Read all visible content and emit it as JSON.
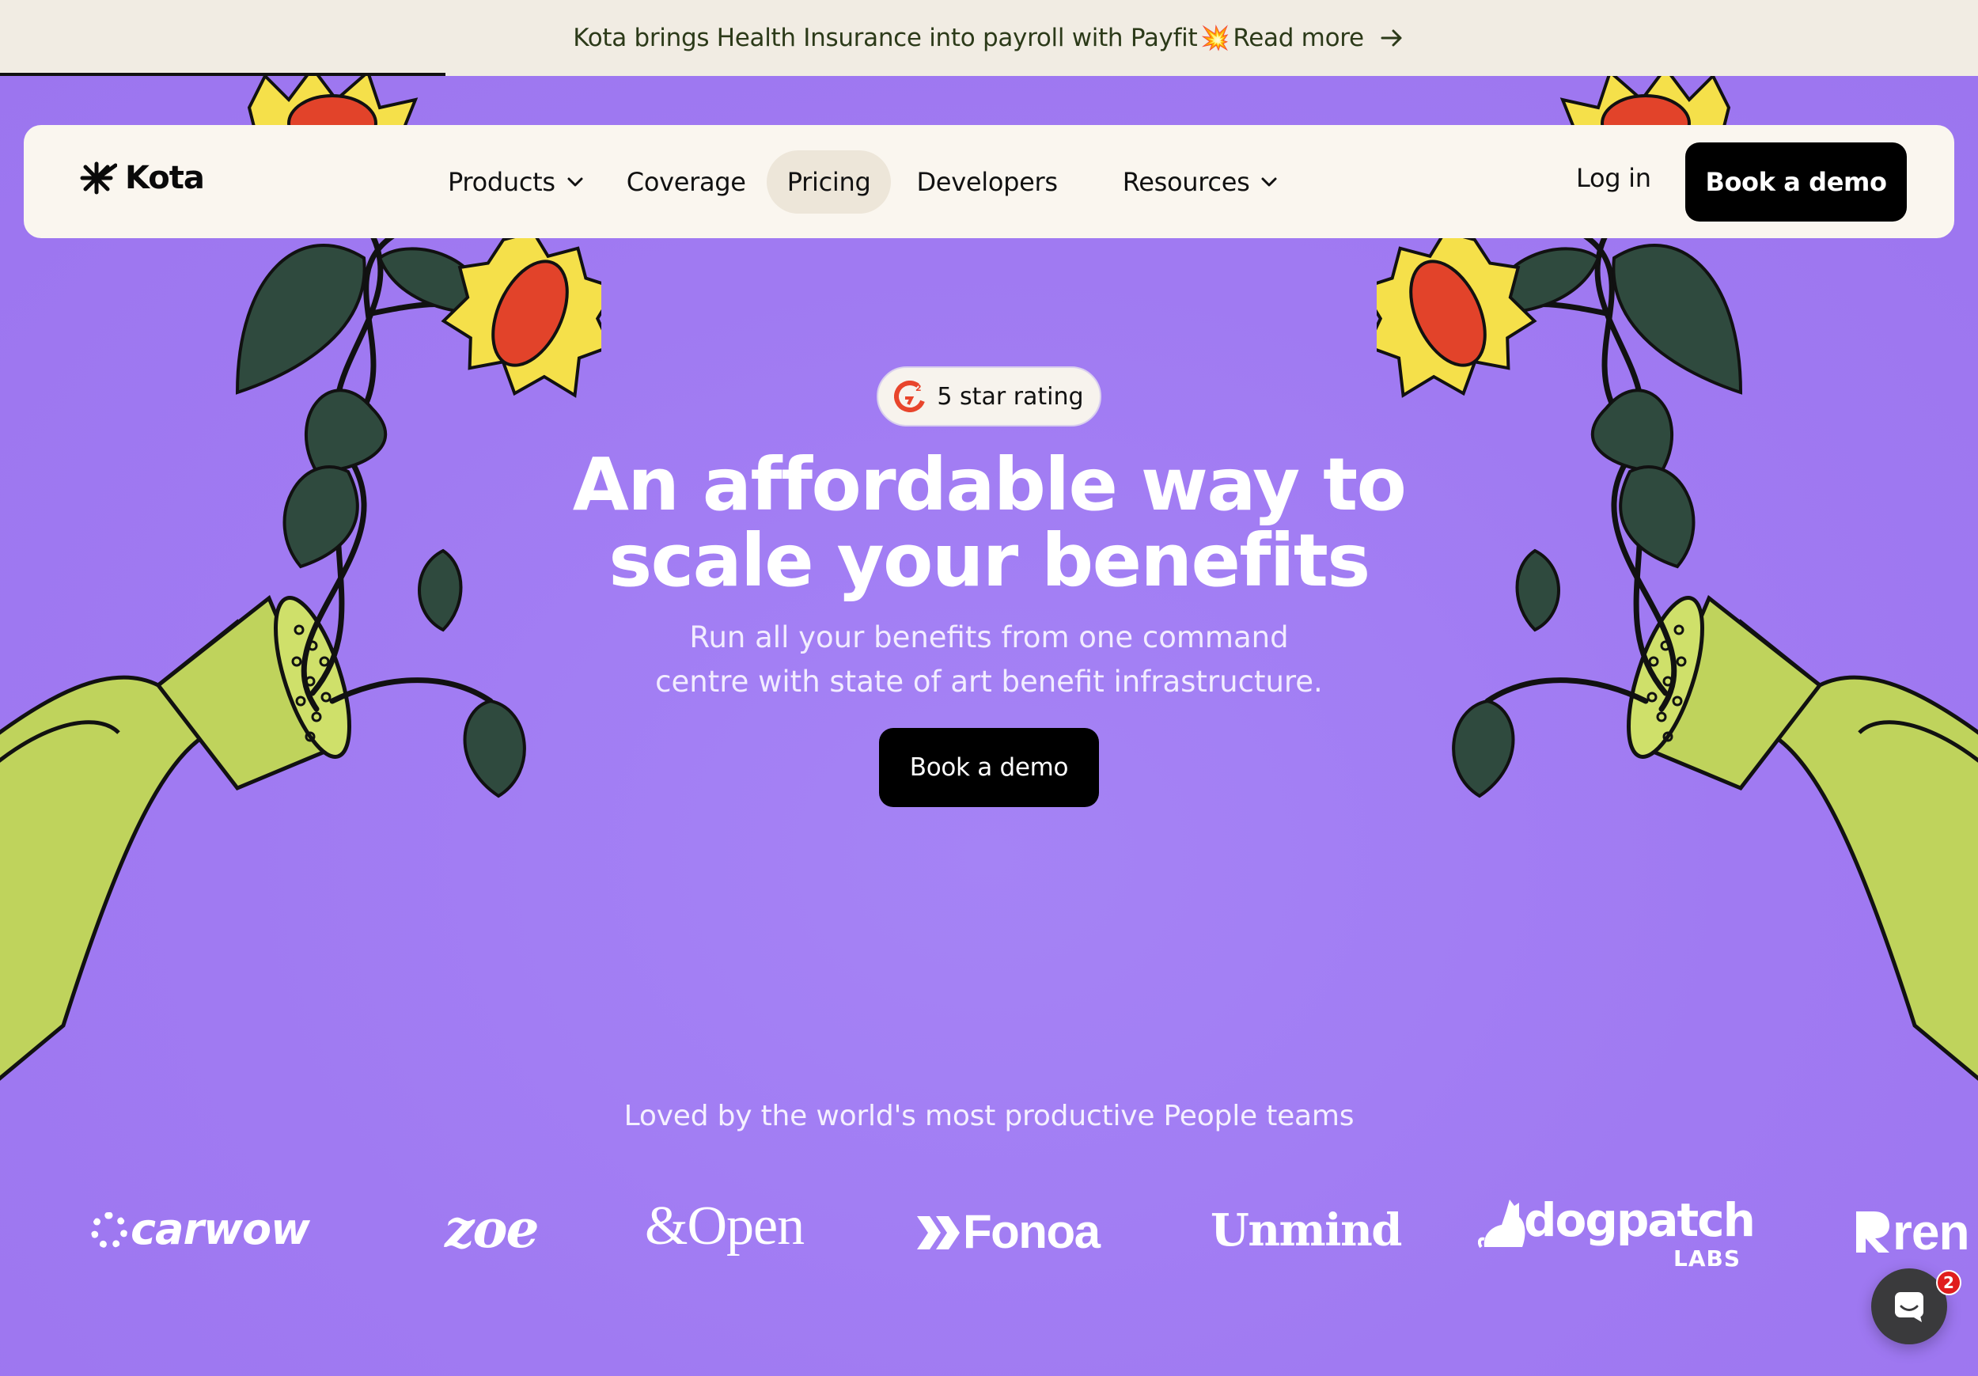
{
  "announcement": {
    "text": "Kota brings Health Insurance into payroll with Payfit",
    "emoji": "💥",
    "link": "Read more",
    "progress": 0.225
  },
  "nav": {
    "logo": "Kota",
    "items": [
      {
        "label": "Products",
        "dropdown": true
      },
      {
        "label": "Coverage",
        "dropdown": false
      },
      {
        "label": "Pricing",
        "dropdown": false,
        "active": true
      },
      {
        "label": "Developers",
        "dropdown": false
      },
      {
        "label": "Resources",
        "dropdown": true
      }
    ],
    "login": "Log in",
    "cta": "Book a demo"
  },
  "hero": {
    "badge": "5 star rating",
    "headline_line1": "An affordable way to",
    "headline_line2": "scale your benefits",
    "subline_line1": "Run all your benefits from one command",
    "subline_line2": "centre with state of art benefit infrastructure.",
    "cta": "Book a demo"
  },
  "social_proof": {
    "heading": "Loved by the world's most productive People teams",
    "logos": [
      "carwow",
      "zoe",
      "&Open",
      "Fonoa",
      "Unmind",
      "dogpatch",
      "LABS",
      "ren"
    ]
  },
  "chat": {
    "unread": "2"
  },
  "colors": {
    "background": "#a47ef3",
    "announcement_bg": "#f1ece3",
    "nav_bg": "#faf6ef",
    "cta_bg": "#000000",
    "petals": "#f5e04a",
    "flower_center": "#e2432a",
    "leaves": "#2f4a3e",
    "watering_can": "#bfd35c"
  }
}
